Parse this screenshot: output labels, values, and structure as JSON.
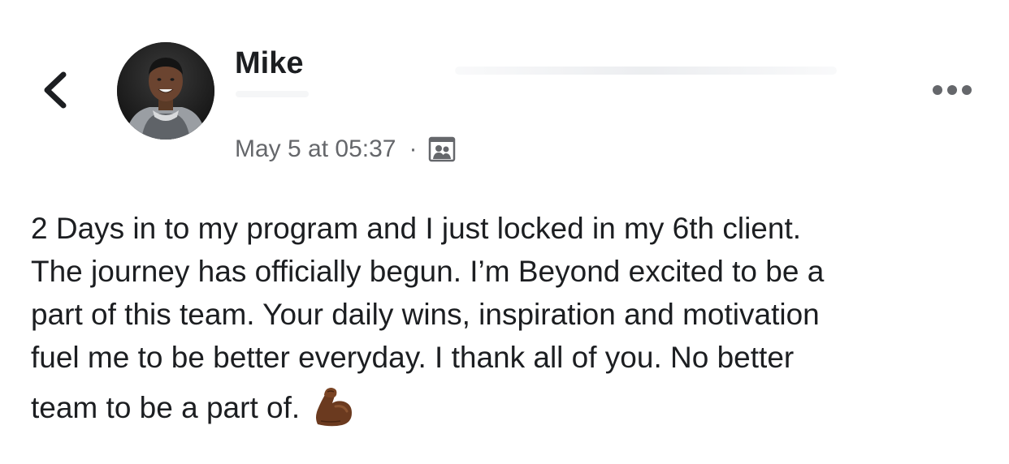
{
  "post": {
    "author": {
      "name": "Mike"
    },
    "meta": {
      "timestamp": "May 5 at 05:37",
      "separator": "·",
      "audience_icon": "group-photo-icon"
    },
    "text_lines": [
      "2 Days in to my program and I just locked in my 6th client.",
      "The journey has officially begun. I’m Beyond excited to be a",
      "part of this team. Your daily wins, inspiration and motivation",
      "fuel me to be better everyday. I thank all of you. No better",
      "team to be a part of."
    ],
    "emoji": "flexed-biceps-icon"
  },
  "icons": {
    "back": "chevron-left-icon",
    "more": "more-dots-icon"
  },
  "colors": {
    "text": "#1c1e21",
    "secondary_text": "#65676b",
    "emoji_skin": "#6b3a1f"
  }
}
